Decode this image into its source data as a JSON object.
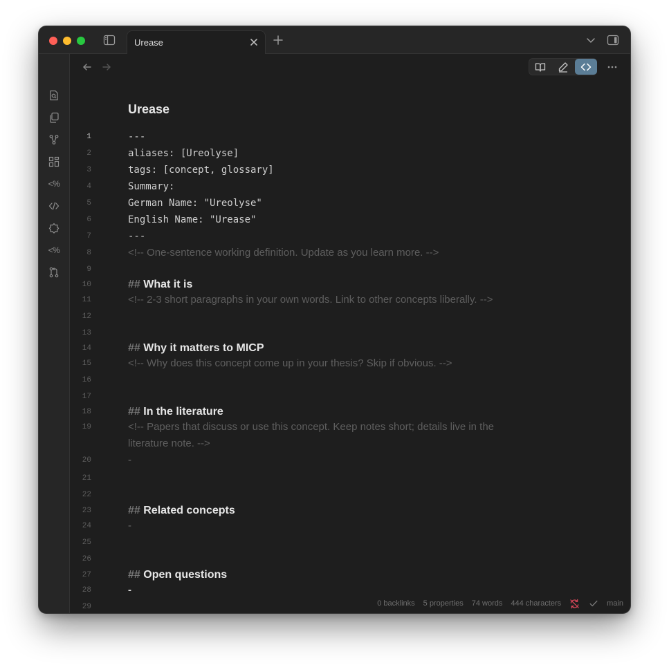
{
  "tab": {
    "title": "Urease"
  },
  "note": {
    "title": "Urease",
    "line_numbers": [
      "1",
      "2",
      "3",
      "4",
      "5",
      "6",
      "7",
      "8",
      "9",
      "10",
      "11",
      "12",
      "13",
      "14",
      "15",
      "16",
      "17",
      "18",
      "19",
      "20",
      "21",
      "22",
      "23",
      "24",
      "25",
      "26",
      "27",
      "28",
      "29"
    ],
    "lines": {
      "l1": "---",
      "l2": "aliases: [Ureolyse]",
      "l3": "tags: [concept, glossary]",
      "l4": "Summary:",
      "l5": "German Name: \"Ureolyse\"",
      "l6": "English Name: \"Urease\"",
      "l7": "---",
      "l8": "<!-- One-sentence working definition. Update as you learn more. -->",
      "l10_hash": "##",
      "l10": "What it is",
      "l11": "<!-- 2-3 short paragraphs in your own words. Link to other concepts liberally. -->",
      "l14_hash": "##",
      "l14": "Why it matters to MICP",
      "l15": "<!-- Why does this concept come up in your thesis? Skip if obvious. -->",
      "l18_hash": "##",
      "l18": "In the literature",
      "l19a": "<!-- Papers that discuss or use this concept. Keep notes short; details live in the",
      "l19b": "literature note. -->",
      "l20": "-",
      "l23_hash": "##",
      "l23": "Related concepts",
      "l24": "-",
      "l27_hash": "##",
      "l27": "Open questions",
      "l28": "-"
    }
  },
  "ribbon": {
    "templater_1": "<%",
    "templater_2": "<%"
  },
  "status_bar": {
    "backlinks": "0 backlinks",
    "properties": "5 properties",
    "words": "74 words",
    "characters": "444 characters",
    "branch": "main"
  },
  "colors": {
    "accent": "#5b7d96",
    "sync_error": "#e0485c",
    "background": "#1e1e1e"
  }
}
